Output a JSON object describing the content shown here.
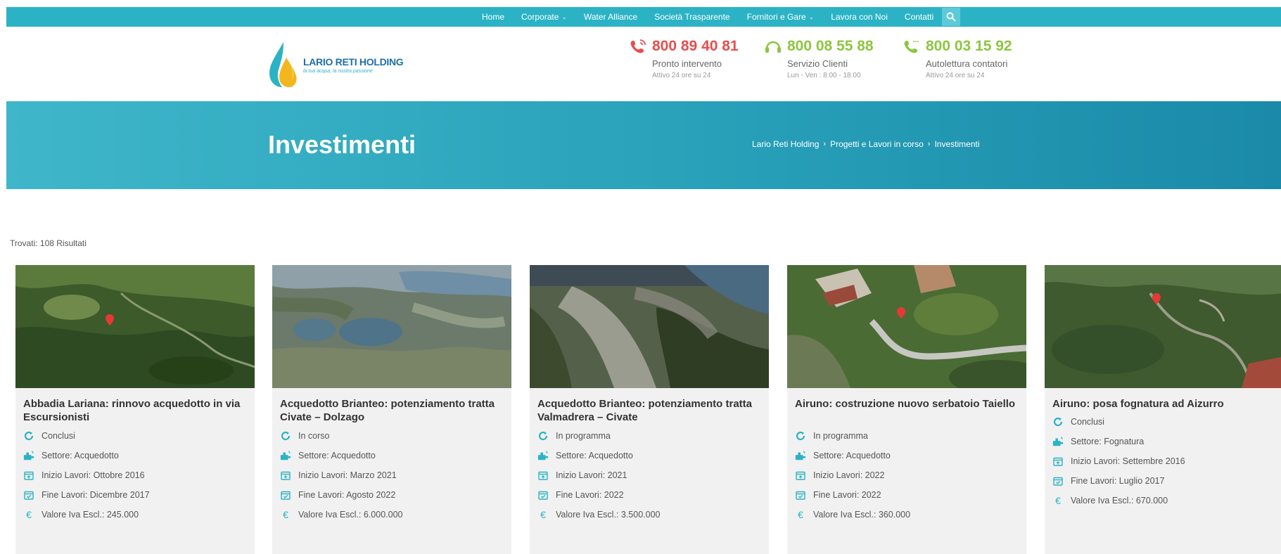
{
  "topnav": {
    "items": [
      {
        "label": "Home",
        "dropdown": false
      },
      {
        "label": "Corporate",
        "dropdown": true
      },
      {
        "label": "Water Alliance",
        "dropdown": false
      },
      {
        "label": "Società Trasparente",
        "dropdown": false
      },
      {
        "label": "Fornitori e Gare",
        "dropdown": true
      },
      {
        "label": "Lavora con Noi",
        "dropdown": false
      },
      {
        "label": "Contatti",
        "dropdown": false
      }
    ],
    "search_icon": "search-icon"
  },
  "logo": {
    "title": "LARIO RETI HOLDING",
    "tagline": "la tua acqua, la nostra passione"
  },
  "contacts": [
    {
      "number": "800 89 40 81",
      "label": "Pronto intervento",
      "hours": "Attivo 24 ore su 24",
      "color": "#e84d4d",
      "icon": "phone-ringing-icon"
    },
    {
      "number": "800 08 55 88",
      "label": "Servizio Clienti",
      "hours": "Lun - Ven : 8:00 - 18:00",
      "color": "#8cc63f",
      "icon": "headset-icon"
    },
    {
      "number": "800 03 15 92",
      "label": "Autolettura contatori",
      "hours": "Attivo 24 ore su 24",
      "color": "#8cc63f",
      "icon": "phone-icon"
    }
  ],
  "hero": {
    "title": "Investimenti",
    "breadcrumb": [
      "Lario Reti Holding",
      "Progetti e Lavori in corso",
      "Investimenti"
    ]
  },
  "results": {
    "text": "Trovati: 108 Risultati"
  },
  "cards": [
    {
      "title": "Abbadia Lariana: rinnovo acquedotto in via Escursionisti",
      "status": "Conclusi",
      "sector": "Settore: Acquedotto",
      "start": "Inizio Lavori: Ottobre 2016",
      "end": "Fine Lavori: Dicembre 2017",
      "value": "Valore Iva Escl.: 245.000"
    },
    {
      "title": "Acquedotto Brianteo: potenziamento tratta Civate – Dolzago",
      "status": "In corso",
      "sector": "Settore: Acquedotto",
      "start": "Inizio Lavori: Marzo 2021",
      "end": "Fine Lavori: Agosto 2022",
      "value": "Valore Iva Escl.: 6.000.000"
    },
    {
      "title": "Acquedotto Brianteo: potenziamento tratta Valmadrera – Civate",
      "status": "In programma",
      "sector": "Settore: Acquedotto",
      "start": "Inizio Lavori: 2021",
      "end": "Fine Lavori: 2022",
      "value": "Valore Iva Escl.: 3.500.000"
    },
    {
      "title": "Airuno: costruzione nuovo serbatoio Taiello",
      "status": "In programma",
      "sector": "Settore: Acquedotto",
      "start": "Inizio Lavori: 2022",
      "end": "Fine Lavori: 2022",
      "value": "Valore Iva Escl.: 360.000"
    },
    {
      "title": "Airuno: posa fognatura ad Aizurro",
      "status": "Conclusi",
      "sector": "Settore: Fognatura",
      "start": "Inizio Lavori: Settembre 2016",
      "end": "Fine Lavori: Luglio 2017",
      "value": "Valore Iva Escl.: 670.000"
    }
  ],
  "colors": {
    "nav_bg": "#2bb3c5",
    "accent": "#2bb3c5",
    "red": "#e84d4d",
    "green": "#8cc63f"
  }
}
